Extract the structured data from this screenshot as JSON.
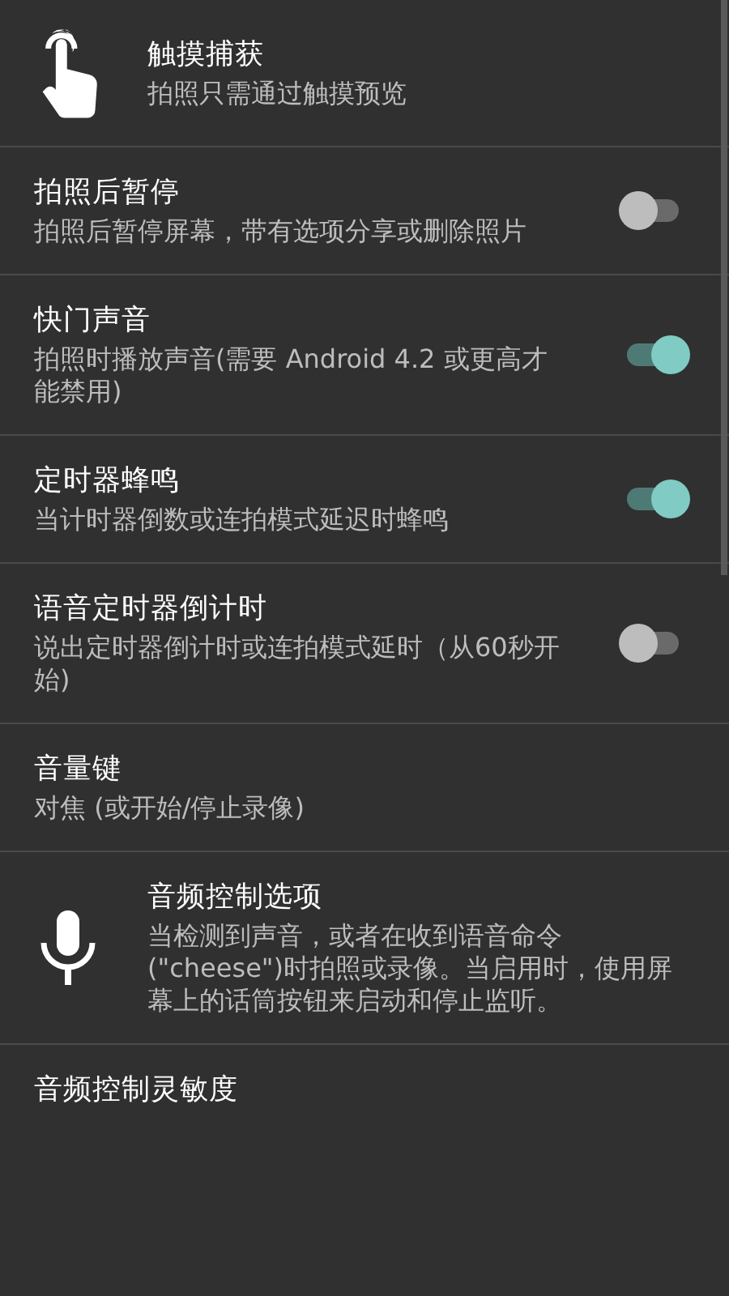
{
  "settings": [
    {
      "kind": "touch",
      "title": "触摸捕获",
      "summary": "拍照只需通过触摸预览"
    },
    {
      "kind": "toggle",
      "title": "拍照后暂停",
      "summary": "拍照后暂停屏幕，带有选项分享或删除照片",
      "on": false
    },
    {
      "kind": "toggle",
      "title": "快门声音",
      "summary": "拍照时播放声音(需要 Android 4.2 或更高才能禁用)",
      "on": true
    },
    {
      "kind": "toggle",
      "title": "定时器蜂鸣",
      "summary": "当计时器倒数或连拍模式延迟时蜂鸣",
      "on": true
    },
    {
      "kind": "toggle",
      "title": "语音定时器倒计时",
      "summary": "说出定时器倒计时或连拍模式延时（从60秒开始)",
      "on": false
    },
    {
      "kind": "plain",
      "title": "音量键",
      "summary": "对焦 (或开始/停止录像)"
    },
    {
      "kind": "microphone",
      "title": "音频控制选项",
      "summary": "当检测到声音，或者在收到语音命令(\"cheese\")时拍照或录像。当启用时，使用屏幕上的话筒按钮来启动和停止监听。"
    },
    {
      "kind": "plain",
      "title": "音频控制灵敏度"
    }
  ]
}
